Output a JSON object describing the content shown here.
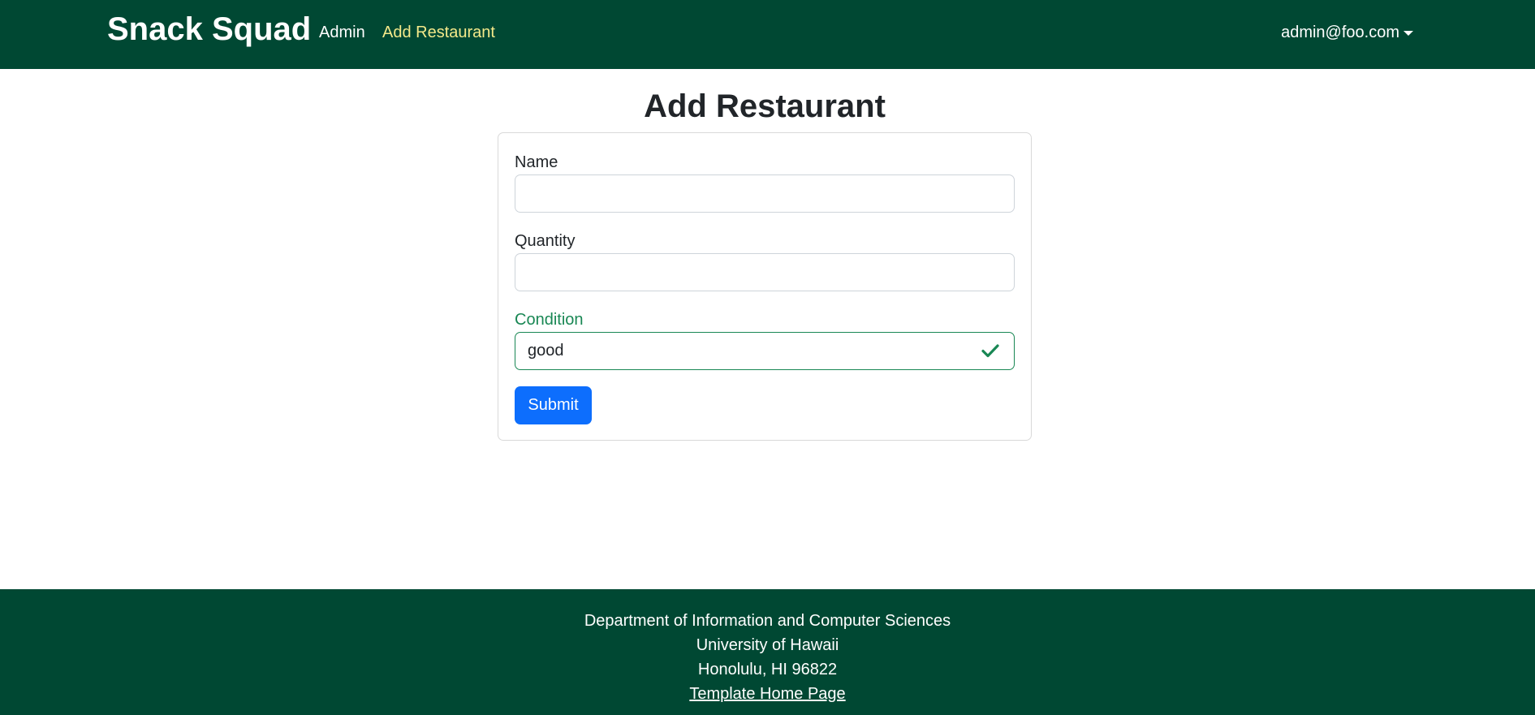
{
  "navbar": {
    "brand": "Snack Squad",
    "links": [
      {
        "label": "Admin"
      },
      {
        "label": "Add Restaurant"
      }
    ],
    "user": "admin@foo.com",
    "colors": {
      "background": "#004833",
      "active_link": "#f4e98a"
    }
  },
  "page": {
    "title": "Add Restaurant"
  },
  "form": {
    "fields": [
      {
        "label": "Name",
        "value": ""
      },
      {
        "label": "Quantity",
        "value": ""
      },
      {
        "label": "Condition",
        "value": "good",
        "state": "valid",
        "icon": "check-icon"
      }
    ],
    "submit_label": "Submit",
    "colors": {
      "valid": "#198754",
      "submit": "#0d6efd"
    }
  },
  "footer": {
    "lines": [
      "Department of Information and Computer Sciences",
      "University of Hawaii",
      "Honolulu, HI 96822"
    ],
    "link_label": "Template Home Page"
  }
}
